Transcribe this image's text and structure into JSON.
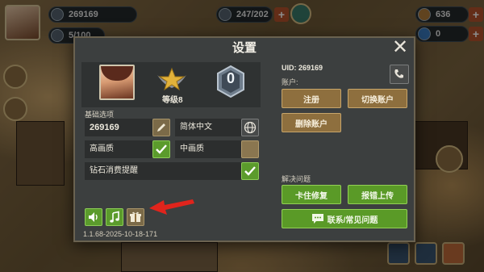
{
  "hud": {
    "player_id": "269169",
    "energy": "5/100",
    "stamina": "247/202",
    "currency1": "636",
    "currency2": "0"
  },
  "dialog": {
    "title": "设置",
    "close_label": "✕",
    "player": {
      "rank_label": "等级8",
      "badge_value": "0"
    },
    "basic_section_label": "基础选项",
    "name_value": "269169",
    "language_value": "简体中文",
    "hq_label": "高画质",
    "mq_label": "中画质",
    "diamond_label": "钻石消费提醒",
    "hq_checked": true,
    "mq_checked": false,
    "diamond_checked": true,
    "uid_label": "UID: 269169",
    "account_label": "账户:",
    "register_label": "注册",
    "switch_account_label": "切换账户",
    "delete_account_label": "删除账户",
    "solve_section_label": "解决问题",
    "stuck_fix_label": "卡住修复",
    "report_upload_label": "报错上传",
    "contact_faq_label": "联系/常见问题",
    "version": "1.1.68-2025-10-18-171"
  },
  "colors": {
    "dialog_bg": "#3c3f3f",
    "action_brown": "#8e6f3e",
    "action_green": "#5a9a27",
    "arrow_red": "#e0241c"
  },
  "icons": [
    "pencil-icon",
    "globe-icon",
    "check-icon",
    "phone-icon",
    "speaker-icon",
    "music-icon",
    "gift-icon",
    "chat-icon"
  ]
}
